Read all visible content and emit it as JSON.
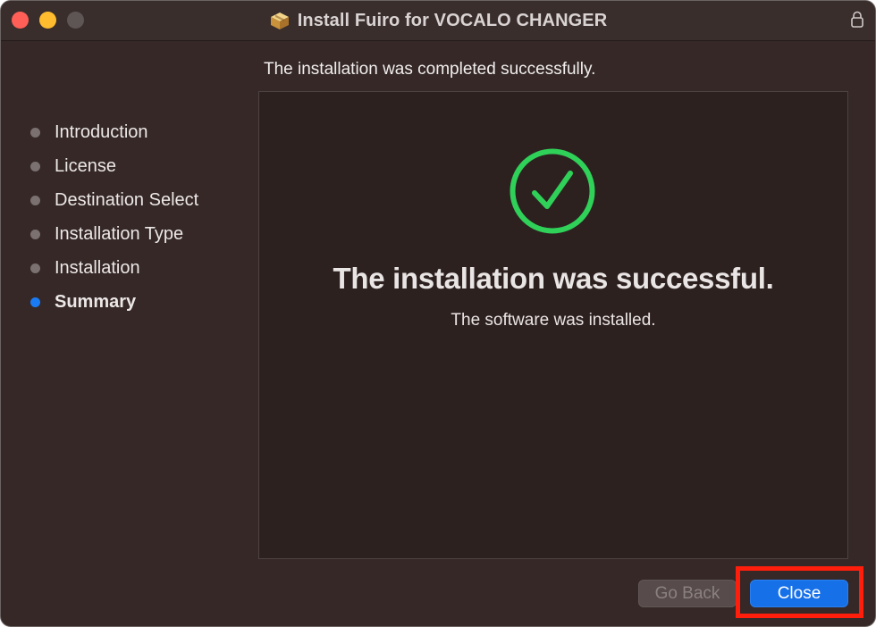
{
  "window": {
    "title": "Install Fuiro for VOCALO CHANGER",
    "title_icon": "package-icon",
    "lock_icon": "lock-icon"
  },
  "header": {
    "status_text": "The installation was completed successfully."
  },
  "sidebar": {
    "steps": [
      {
        "label": "Introduction",
        "active": false
      },
      {
        "label": "License",
        "active": false
      },
      {
        "label": "Destination Select",
        "active": false
      },
      {
        "label": "Installation Type",
        "active": false
      },
      {
        "label": "Installation",
        "active": false
      },
      {
        "label": "Summary",
        "active": true
      }
    ]
  },
  "main": {
    "icon": "checkmark-circle-icon",
    "title": "The installation was successful.",
    "subtitle": "The software was installed."
  },
  "footer": {
    "back_label": "Go Back",
    "back_enabled": false,
    "close_label": "Close"
  },
  "colors": {
    "accent": "#1670e8",
    "success": "#2fd158",
    "highlight": "#ff1d0c",
    "background": "#352827"
  }
}
